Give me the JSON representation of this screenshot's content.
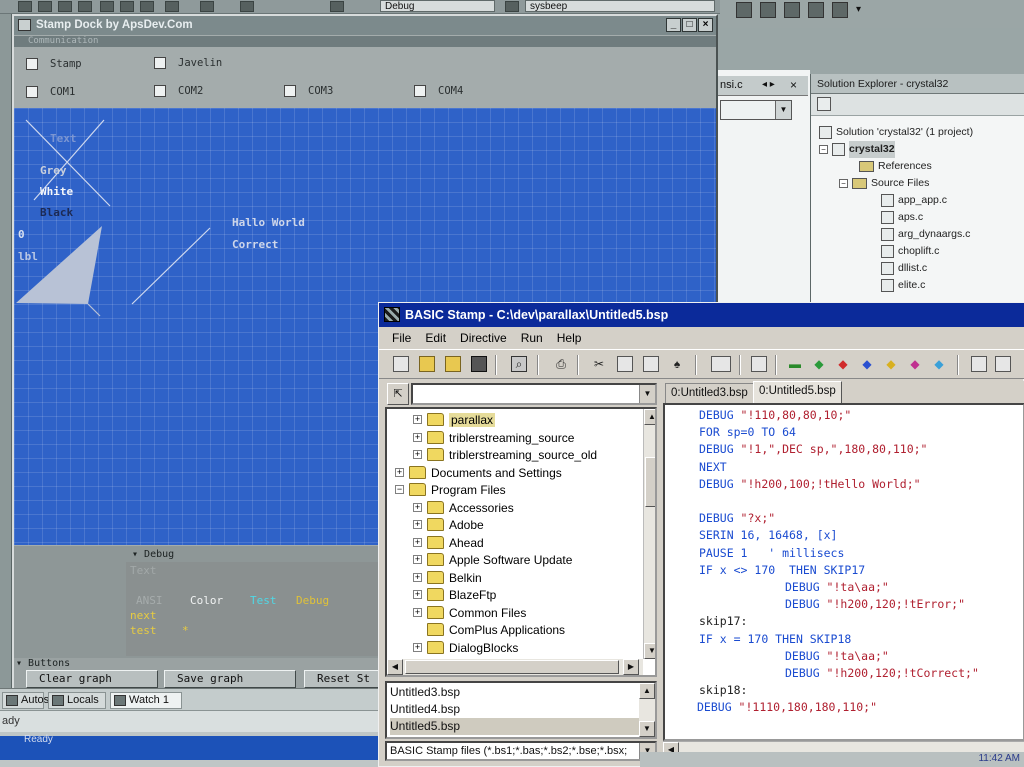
{
  "top_bar": {
    "build_config": "Debug",
    "target_combo": "sysbeep"
  },
  "stamp_dock": {
    "title": "Stamp Dock by ApsDev.Com",
    "comm_label": "Communication",
    "checkboxes": [
      {
        "label": "Stamp",
        "checked": false
      },
      {
        "label": "Javelin",
        "checked": false
      },
      {
        "label": "COM1",
        "checked": false
      },
      {
        "label": "COM2",
        "checked": false
      },
      {
        "label": "COM3",
        "checked": false
      },
      {
        "label": "COM4",
        "checked": false
      }
    ],
    "graph_texts": {
      "label_0": "Text",
      "grey": "Grey",
      "white": "White",
      "black": "Black",
      "zero": "0",
      "lbl": "lbl",
      "hello": "Hallo World",
      "correct": "Correct"
    },
    "debug": {
      "header": "Debug",
      "text_label": "Text",
      "ansi": "ANSI",
      "color": "Color",
      "test": "Test",
      "debug_word": "Debug",
      "next": "next",
      "test_lower": "test",
      "star": "*"
    },
    "buttons_header": "Buttons",
    "buttons": [
      "Clear graph",
      "Save graph",
      "Reset St"
    ]
  },
  "ide_bottom": {
    "tabs": [
      "Autos",
      "Locals",
      "Watch 1"
    ],
    "status": "ady",
    "taskbar_item": "Ready"
  },
  "editor_tab": {
    "label": "nsi.c"
  },
  "solution_explorer": {
    "title": "Solution Explorer - crystal32",
    "items": [
      {
        "label": "Solution 'crystal32' (1 project)"
      },
      {
        "label": "crystal32"
      },
      {
        "label": "References"
      },
      {
        "label": "Source Files"
      },
      {
        "label": "app_app.c"
      },
      {
        "label": "aps.c"
      },
      {
        "label": "arg_dynaargs.c"
      },
      {
        "label": "choplift.c"
      },
      {
        "label": "dllist.c"
      },
      {
        "label": "elite.c"
      }
    ]
  },
  "basic_stamp": {
    "title": "BASIC Stamp - C:\\dev\\parallax\\Untitled5.bsp",
    "menu": [
      "File",
      "Edit",
      "Directive",
      "Run",
      "Help"
    ],
    "tree": [
      {
        "label": "parallax",
        "selected": true
      },
      {
        "label": "triblerstreaming_source"
      },
      {
        "label": "triblerstreaming_source_old"
      },
      {
        "label": "Documents and Settings"
      },
      {
        "label": "Program Files"
      },
      {
        "label": "Accessories"
      },
      {
        "label": "Adobe"
      },
      {
        "label": "Ahead"
      },
      {
        "label": "Apple Software Update"
      },
      {
        "label": "Belkin"
      },
      {
        "label": "BlazeFtp"
      },
      {
        "label": "Common Files"
      },
      {
        "label": "ComPlus Applications"
      },
      {
        "label": "DialogBlocks"
      }
    ],
    "files": [
      "Untitled3.bsp",
      "Untitled4.bsp",
      "Untitled5.bsp"
    ],
    "filter": "BASIC Stamp files (*.bs1;*.bas;*.bs2;*.bse;*.bsx;",
    "editor_tabs": [
      "0:Untitled3.bsp",
      "0:Untitled5.bsp"
    ],
    "code": [
      {
        "kw": "DEBUG",
        "rest": " \"!110,80,80,10;\""
      },
      {
        "kw": "FOR",
        "rest": " sp=0 TO 64"
      },
      {
        "kw": "DEBUG",
        "rest": " \"!1,\",DEC sp,\",180,80,110;\""
      },
      {
        "kw": "NEXT",
        "rest": ""
      },
      {
        "kw": "DEBUG",
        "rest": " \"!h200,100;!tHello World;\""
      },
      {
        "kw": "",
        "rest": ""
      },
      {
        "kw": "DEBUG",
        "rest": " \"?x;\""
      },
      {
        "kw": "SERIN",
        "rest": " 16, 16468, [x]"
      },
      {
        "kw": "PAUSE",
        "rest": " 1   ' millisecs"
      },
      {
        "kw": "IF",
        "rest": " x <> 170  THEN SKIP17"
      },
      {
        "kw": "DEBUG",
        "rest": " \"!ta\\aa;\""
      },
      {
        "kw": "DEBUG",
        "rest": " \"!h200,120;!tError;\""
      },
      {
        "kw": "",
        "rest": "skip17:"
      },
      {
        "kw": "IF",
        "rest": " x = 170 THEN SKIP18"
      },
      {
        "kw": "DEBUG",
        "rest": " \"!ta\\aa;\""
      },
      {
        "kw": "DEBUG",
        "rest": " \"!h200,120;!tCorrect;\""
      },
      {
        "kw": "",
        "rest": "skip18:"
      },
      {
        "kw": "DEBUG",
        "rest": " \"!1110,180,180,110;\""
      }
    ]
  },
  "clock": "11:42 AM",
  "colors": {
    "graph_bg": "#2f62c8",
    "titlebar": "#0b2a9a",
    "keyword": "#1a4bd0",
    "string": "#b02030"
  }
}
